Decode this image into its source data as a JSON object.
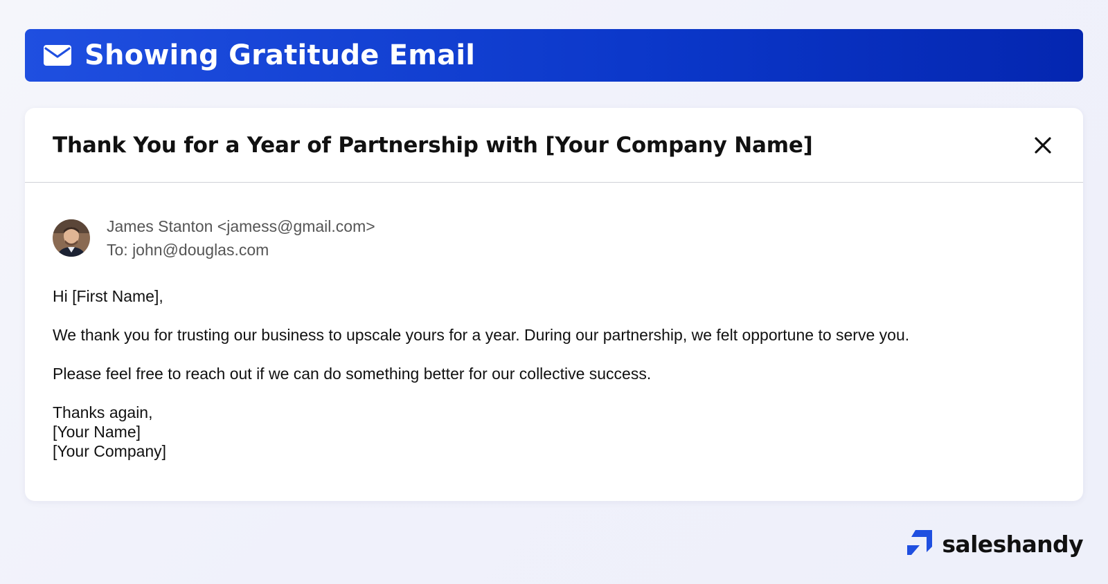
{
  "banner": {
    "title": "Showing Gratitude Email",
    "icon": "mail-icon"
  },
  "email": {
    "subject": "Thank You for a Year of Partnership with [Your Company Name]",
    "close_icon": "close-icon",
    "sender": "James Stanton <jamess@gmail.com>",
    "recipient": "To: john@douglas.com",
    "greeting": "Hi [First Name],",
    "paragraph1": "We thank you for trusting our business to upscale yours for a year. During our partnership, we felt opportune to serve you.",
    "paragraph2": "Please feel free to reach out if we can do something better for our collective success.",
    "signoff": "Thanks again,",
    "sig_name": "[Your Name]",
    "sig_company": "[Your Company]"
  },
  "brand": {
    "name": "saleshandy",
    "accent": "#1f4fe0"
  },
  "colors": {
    "banner_start": "#1f4fe0",
    "banner_end": "#0426b0",
    "text_primary": "#111111",
    "text_secondary": "#555555"
  }
}
